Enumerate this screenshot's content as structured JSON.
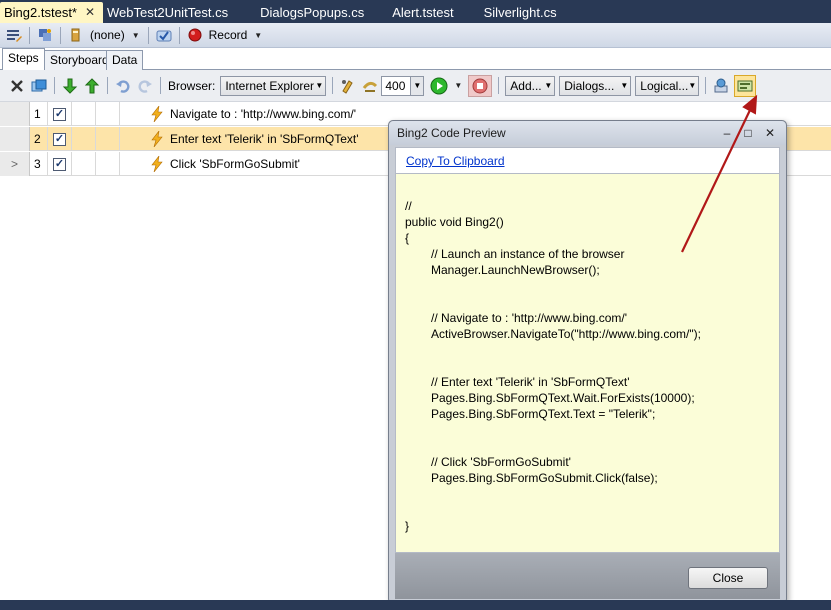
{
  "doc_tabs": [
    {
      "label": "Bing2.tstest*",
      "active": true
    },
    {
      "label": "WebTest2UnitTest.cs"
    },
    {
      "label": "DialogsPopups.cs"
    },
    {
      "label": "Alert.tstest"
    },
    {
      "label": "Silverlight.cs"
    }
  ],
  "top_toolbar": {
    "config_label": "(none)",
    "record_label": "Record"
  },
  "sub_tabs": [
    "Steps",
    "Storyboard",
    "Data"
  ],
  "steps_toolbar": {
    "browser_label": "Browser:",
    "browser_value": "Internet Explorer",
    "delay_value": "400",
    "add_label": "Add...",
    "dialogs_label": "Dialogs...",
    "logical_label": "Logical..."
  },
  "steps": [
    {
      "num": "1",
      "description": "Navigate to : 'http://www.bing.com/'"
    },
    {
      "num": "2",
      "description": "Enter text 'Telerik' in 'SbFormQText'"
    },
    {
      "num": "3",
      "description": "Click 'SbFormGoSubmit'"
    }
  ],
  "dialog": {
    "title": "Bing2 Code Preview",
    "copy_link": "Copy To Clipboard",
    "close_label": "Close",
    "code": {
      "l1": "//",
      "l2": "public void Bing2()",
      "l3": "{",
      "l4": "// Launch an instance of the browser",
      "l5": "Manager.LaunchNewBrowser();",
      "l6": "// Navigate to : 'http://www.bing.com/'",
      "l7": "ActiveBrowser.NavigateTo(\"http://www.bing.com/\");",
      "l8": "// Enter text 'Telerik' in 'SbFormQText'",
      "l9": "Pages.Bing.SbFormQText.Wait.ForExists(10000);",
      "l10": "Pages.Bing.SbFormQText.Text = \"Telerik\";",
      "l11": "// Click 'SbFormGoSubmit'",
      "l12": "Pages.Bing.SbFormGoSubmit.Click(false);",
      "l13": "}"
    }
  },
  "colors": {
    "chrome_dark": "#293955",
    "selected_row": "#fde4a9",
    "code_background": "#fbfdd8",
    "annotation_arrow": "#b11818"
  }
}
